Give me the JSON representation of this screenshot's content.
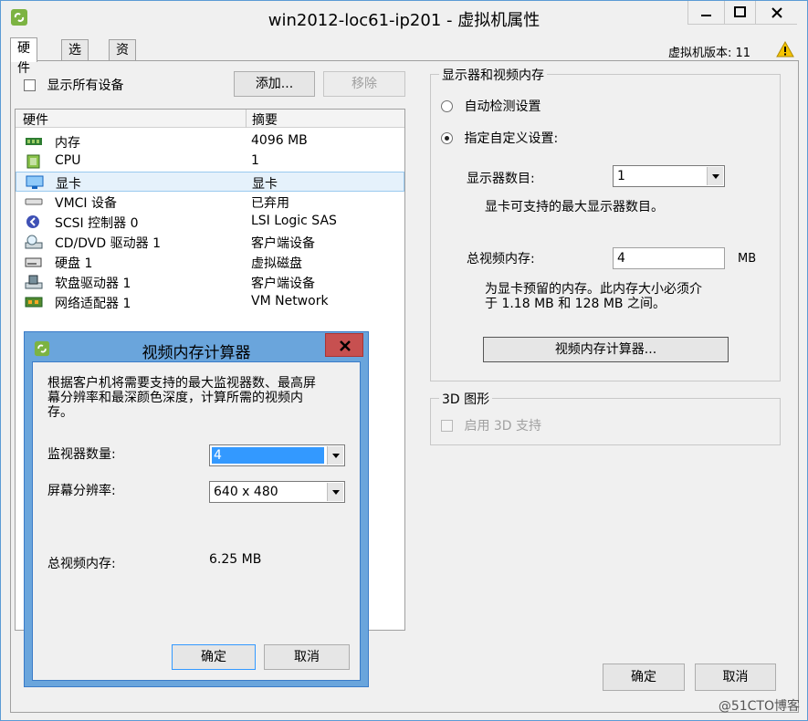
{
  "window": {
    "title": "win2012-loc61-ip201 - 虚拟机属性"
  },
  "tabs": [
    {
      "label": "硬件"
    },
    {
      "label": "选项"
    },
    {
      "label": "资源"
    }
  ],
  "version_text": "虚拟机版本: 11",
  "hardware": {
    "show_all_label": "显示所有设备",
    "add_label": "添加...",
    "remove_label": "移除",
    "col_hardware": "硬件",
    "col_summary": "摘要",
    "rows": [
      {
        "name": "内存",
        "summary": "4096 MB",
        "icon": "memory-icon"
      },
      {
        "name": "CPU",
        "summary": "1",
        "icon": "cpu-icon"
      },
      {
        "name": "显卡",
        "summary": "显卡",
        "icon": "display-icon"
      },
      {
        "name": "VMCI 设备",
        "summary": "已弃用",
        "icon": "vmci-icon"
      },
      {
        "name": "SCSI 控制器  0",
        "summary": "LSI Logic SAS",
        "icon": "scsi-icon"
      },
      {
        "name": "CD/DVD 驱动器  1",
        "summary": "客户端设备",
        "icon": "cdrom-icon"
      },
      {
        "name": "硬盘  1",
        "summary": "虚拟磁盘",
        "icon": "harddisk-icon"
      },
      {
        "name": "软盘驱动器  1",
        "summary": "客户端设备",
        "icon": "floppy-icon"
      },
      {
        "name": "网络适配器  1",
        "summary": "VM Network",
        "icon": "network-icon"
      }
    ]
  },
  "display_group": {
    "title": "显示器和视频内存",
    "auto_detect_label": "自动检测设置",
    "custom_label": "指定自定义设置:",
    "monitors_label": "显示器数目:",
    "monitors_value": "1",
    "monitors_help": "显卡可支持的最大显示器数目。",
    "vram_label": "总视频内存:",
    "vram_value": "4",
    "vram_unit": "MB",
    "vram_help_1": "为显卡预留的内存。此内存大小必须介",
    "vram_help_2": "于 1.18 MB 和 128 MB 之间。",
    "calculator_button": "视频内存计算器..."
  },
  "group_3d": {
    "title": "3D 图形",
    "enable_label": "启用 3D 支持"
  },
  "main_buttons": {
    "ok": "确定",
    "cancel": "取消"
  },
  "dialog": {
    "title": "视频内存计算器",
    "description_1": "根据客户机将需要支持的最大监视器数、最高屏",
    "description_2": "幕分辨率和最深颜色深度，计算所需的视频内",
    "description_3": "存。",
    "monitors_label": "监视器数量:",
    "monitors_value": "4",
    "resolution_label": "屏幕分辨率:",
    "resolution_value": "640 x 480",
    "total_label": "总视频内存:",
    "total_value": "6.25 MB",
    "ok": "确定",
    "cancel": "取消"
  },
  "watermark": "@51CTO博客"
}
